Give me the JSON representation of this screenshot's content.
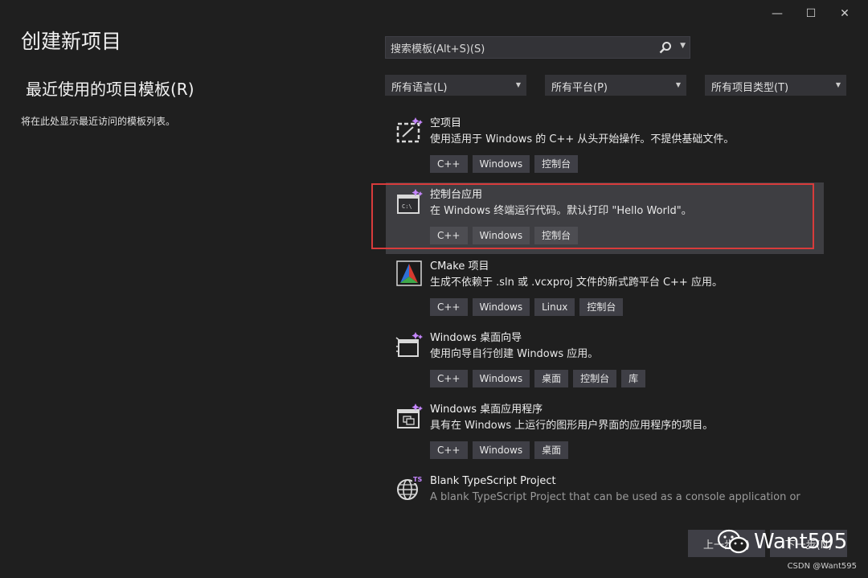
{
  "window": {
    "title": "创建新项目",
    "controls": {
      "minimize": "—",
      "maximize": "☐",
      "close": "✕"
    }
  },
  "recent": {
    "heading": "最近使用的项目模板(R)",
    "empty_text": "将在此处显示最近访问的模板列表。"
  },
  "search": {
    "placeholder": "搜索模板(Alt+S)(S)",
    "icon": "search-icon"
  },
  "filters": {
    "language": "所有语言(L)",
    "platform": "所有平台(P)",
    "project_type": "所有项目类型(T)"
  },
  "templates": [
    {
      "name": "空项目",
      "desc": "使用适用于 Windows 的 C++ 从头开始操作。不提供基础文件。",
      "tags": [
        "C++",
        "Windows",
        "控制台"
      ],
      "icon": "empty-project-icon"
    },
    {
      "name": "控制台应用",
      "desc": "在 Windows 终端运行代码。默认打印 \"Hello World\"。",
      "tags": [
        "C++",
        "Windows",
        "控制台"
      ],
      "icon": "console-app-icon",
      "selected": true
    },
    {
      "name": "CMake 项目",
      "desc": "生成不依赖于 .sln 或 .vcxproj 文件的新式跨平台 C++ 应用。",
      "tags": [
        "C++",
        "Windows",
        "Linux",
        "控制台"
      ],
      "icon": "cmake-icon"
    },
    {
      "name": "Windows 桌面向导",
      "desc": "使用向导自行创建 Windows 应用。",
      "tags": [
        "C++",
        "Windows",
        "桌面",
        "控制台",
        "库"
      ],
      "icon": "desktop-wizard-icon"
    },
    {
      "name": "Windows 桌面应用程序",
      "desc": "具有在 Windows 上运行的图形用户界面的应用程序的项目。",
      "tags": [
        "C++",
        "Windows",
        "桌面"
      ],
      "icon": "desktop-app-icon"
    },
    {
      "name": "Blank TypeScript Project",
      "desc": "A blank TypeScript Project that can be used as a console application or",
      "tags": [],
      "icon": "typescript-globe-icon"
    }
  ],
  "footer": {
    "back_label": "上一步(B)",
    "next_label": "下一步(N)",
    "watermark": "Want595",
    "credit": "CSDN @Want595"
  },
  "colors": {
    "background": "#1f1f1f",
    "selected": "#3e3e42",
    "highlight": "#d83b3b",
    "accent": "#c586ff"
  }
}
